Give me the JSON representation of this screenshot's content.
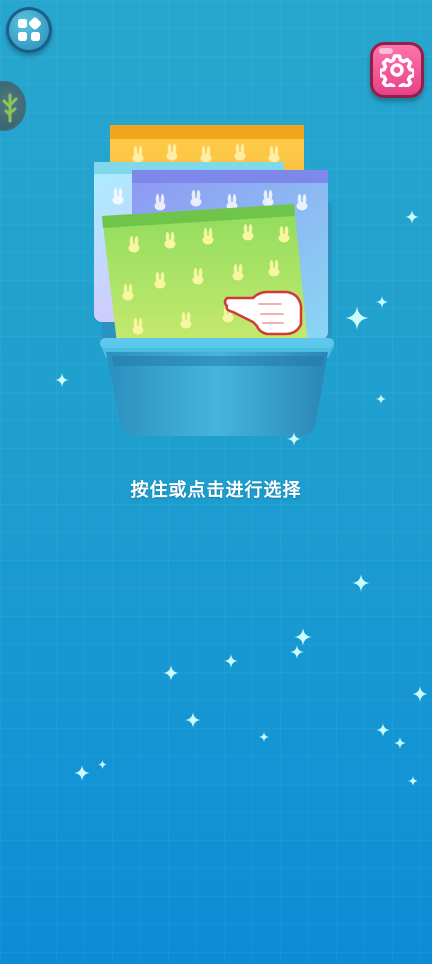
{
  "hint": {
    "text": "按住或点击进行选择"
  },
  "icons": {
    "menu": "grid-four-icon",
    "settings": "gear-icon",
    "side": "plant-icon",
    "pointer": "hand-pointer-icon"
  },
  "colors": {
    "background_top": "#27a6cf",
    "background_bottom": "#0c8cd6",
    "settings_pink": "#e63e86",
    "basket_blue": "#3aa5cf",
    "pack_orange": "#f6b83a",
    "pack_cyan": "#8fe4f0",
    "pack_purple": "#9aa4f5",
    "pack_green": "#98d85c"
  }
}
